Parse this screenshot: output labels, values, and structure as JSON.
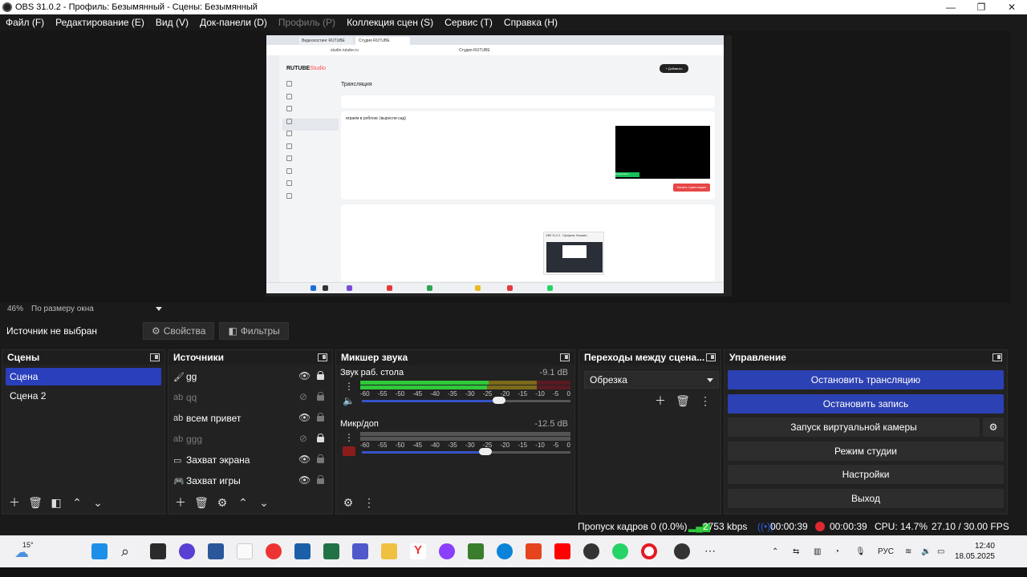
{
  "window": {
    "title": "OBS 31.0.2 - Профиль: Безымянный - Сцены: Безымянный",
    "minimize": "—",
    "maximize": "❐",
    "close": "✕"
  },
  "menu": [
    {
      "label": "Файл (F)",
      "enabled": true
    },
    {
      "label": "Редактирование (E)",
      "enabled": true
    },
    {
      "label": "Вид (V)",
      "enabled": true
    },
    {
      "label": "Док-панели (D)",
      "enabled": true
    },
    {
      "label": "Профиль (P)",
      "enabled": false
    },
    {
      "label": "Коллекция сцен (S)",
      "enabled": true
    },
    {
      "label": "Сервис (T)",
      "enabled": true
    },
    {
      "label": "Справка (H)",
      "enabled": true
    }
  ],
  "preview": {
    "browser": {
      "tabs": [
        "Видеохостинг RUTUBE",
        "Студия RUTUBE"
      ],
      "page_title": "Студия RUTUBE",
      "url": "studio.rutube.ru",
      "logo": "RUTUBE",
      "logo_suffix": "Studio",
      "heading": "Трансляция",
      "add_button": "+ Добавить",
      "stream_title": "играем в роблокс (выросли сад)",
      "finish_button": "Начать трансляцию",
      "go_live_label": "Продолжить",
      "thumb_title": "OBS 31.0.2 - Профиль: Безымя..."
    }
  },
  "zoom": {
    "percent": "46%",
    "mode": "По размеру окна"
  },
  "source_bar": {
    "no_source": "Источник не выбран",
    "properties": "Свойства",
    "filters": "Фильтры"
  },
  "scenes": {
    "title": "Сцены",
    "items": [
      {
        "label": "Сцена",
        "selected": true
      },
      {
        "label": "Сцена 2",
        "selected": false
      }
    ]
  },
  "sources": {
    "title": "Источники",
    "items": [
      {
        "label": "gg",
        "icon": "brush-icon",
        "visible": true,
        "locked": true
      },
      {
        "label": "qq",
        "icon": "text-icon",
        "visible": false,
        "locked": false
      },
      {
        "label": "всем привет",
        "icon": "text-icon",
        "visible": true,
        "locked": false
      },
      {
        "label": "ggg",
        "icon": "text-icon",
        "visible": false,
        "locked": true
      },
      {
        "label": "Захват экрана",
        "icon": "monitor-icon",
        "visible": true,
        "locked": false
      },
      {
        "label": "Захват игры",
        "icon": "gamepad-icon",
        "visible": true,
        "locked": false
      }
    ]
  },
  "mixer": {
    "title": "Микшер звука",
    "channels": [
      {
        "name": "Звук раб. стола",
        "db": "-9.1 dB",
        "muted": false,
        "level": 0.72,
        "volume": 0.68
      },
      {
        "name": "Микр/доп",
        "db": "-12.5 dB",
        "muted": true,
        "level": 0.0,
        "volume": 0.58
      }
    ],
    "ticks": [
      "-60",
      "-55",
      "-50",
      "-45",
      "-40",
      "-35",
      "-30",
      "-25",
      "-20",
      "-15",
      "-10",
      "-5",
      "0"
    ]
  },
  "transitions": {
    "title": "Переходы между сцена...",
    "selected": "Обрезка"
  },
  "controls": {
    "title": "Управление",
    "stop_stream": "Остановить трансляцию",
    "stop_record": "Остановить запись",
    "virtual_cam": "Запуск виртуальной камеры",
    "studio_mode": "Режим студии",
    "settings": "Настройки",
    "exit": "Выход"
  },
  "status": {
    "dropped": "Пропуск кадров 0 (0.0%)",
    "bitrate": "2753 kbps",
    "stream_time": "00:00:39",
    "record_time": "00:00:39",
    "cpu": "CPU: 14.7%",
    "fps": "27.10 / 30.00 FPS"
  },
  "taskbar": {
    "weather": "15°",
    "lang": "РУС",
    "time": "12:40",
    "date": "18.05.2025"
  },
  "colors": {
    "accent": "#2c41b3",
    "meter_green": "#2fc93a",
    "meter_yellow": "#c8b024",
    "meter_red": "#c8283a",
    "record_red": "#e0282e"
  }
}
